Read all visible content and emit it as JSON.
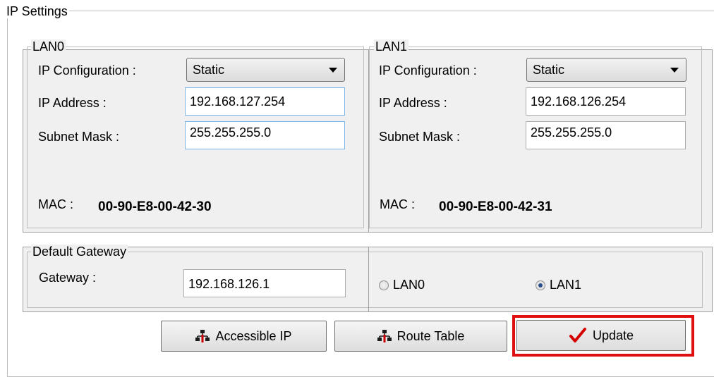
{
  "ip_settings": {
    "title": "IP Settings",
    "lan0": {
      "title": "LAN0",
      "ip_config_label": "IP Configuration :",
      "ip_config_value": "Static",
      "ip_address_label": "IP Address :",
      "ip_address_value": "192.168.127.254",
      "subnet_label": "Subnet Mask :",
      "subnet_value": "255.255.255.0",
      "mac_label": "MAC :",
      "mac_value": "00-90-E8-00-42-30"
    },
    "lan1": {
      "title": "LAN1",
      "ip_config_label": "IP Configuration :",
      "ip_config_value": "Static",
      "ip_address_label": "IP Address :",
      "ip_address_value": "192.168.126.254",
      "subnet_label": "Subnet Mask :",
      "subnet_value": "255.255.255.0",
      "mac_label": "MAC :",
      "mac_value": "00-90-E8-00-42-31"
    },
    "gateway": {
      "title": "Default Gateway",
      "label": "Gateway :",
      "value": "192.168.126.1",
      "radio_lan0": "LAN0",
      "radio_lan1": "LAN1",
      "selected": "LAN1"
    },
    "buttons": {
      "accessible_ip": "Accessible IP",
      "route_table": "Route Table",
      "update": "Update"
    },
    "icons": {
      "network": "network-icon",
      "check": "checkmark-icon"
    },
    "colors": {
      "highlight": "#e01010",
      "check": "#d40000"
    }
  }
}
